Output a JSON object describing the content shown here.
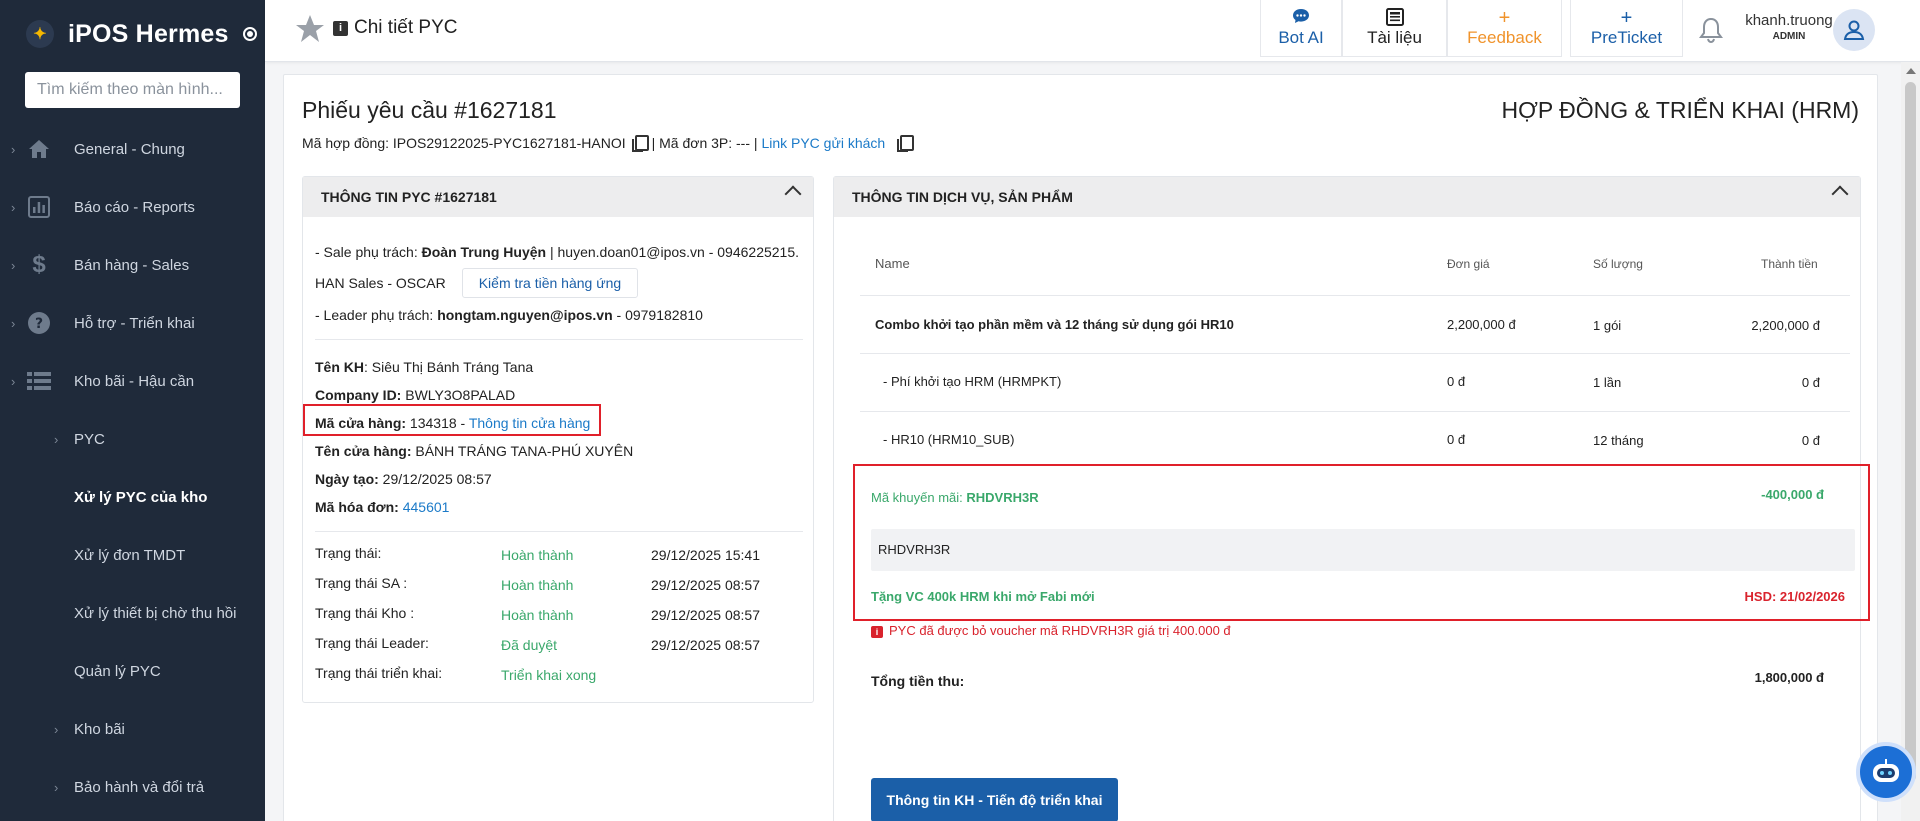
{
  "app": {
    "title": "iPOS Hermes"
  },
  "sidebar": {
    "search_placeholder": "Tìm kiếm theo màn hình...",
    "items": [
      {
        "label": "General - Chung",
        "icon": "home-icon"
      },
      {
        "label": "Báo cáo - Reports",
        "icon": "report-icon"
      },
      {
        "label": "Bán hàng - Sales",
        "icon": "dollar-icon"
      },
      {
        "label": "Hỗ trợ - Triển khai",
        "icon": "help-icon"
      },
      {
        "label": "Kho bãi - Hậu cần",
        "icon": "list-icon"
      }
    ],
    "subitems": [
      {
        "label": "PYC",
        "has_chevron": true
      },
      {
        "label": "Xử lý PYC của kho",
        "active": true
      },
      {
        "label": "Xử lý đơn TMDT"
      },
      {
        "label": "Xử lý thiết bị chờ thu hồi"
      },
      {
        "label": "Quản lý PYC"
      },
      {
        "label": "Kho bãi",
        "has_chevron": true
      },
      {
        "label": "Bảo hành và đổi trả",
        "has_chevron": true
      }
    ]
  },
  "header": {
    "page_title": "Chi tiết PYC",
    "info_icon_text": "i",
    "buttons": [
      {
        "label": "Bot AI",
        "icon": "chat-icon",
        "glyph": "💬"
      },
      {
        "label": "Tài liệu",
        "icon": "document-icon",
        "glyph": "📰"
      },
      {
        "label": "Feedback",
        "icon": "plus-icon",
        "glyph": "+"
      },
      {
        "label": "PreTicket",
        "icon": "plus-icon",
        "glyph": "+"
      }
    ],
    "user": {
      "name": "khanh.truong",
      "role": "ADMIN"
    }
  },
  "ticket": {
    "title": "Phiếu yêu cầu #1627181",
    "department": "HỢP ĐỒNG & TRIỂN KHAI (HRM)",
    "contract_label": "Mã hợp đồng: IPOS29122025-PYC1627181-HANOI",
    "order3p_label": "| Mã đơn 3P: --- |",
    "link_label": "Link PYC gửi khách"
  },
  "left_panel": {
    "header": "THÔNG TIN PYC #1627181",
    "sale_prefix": "- Sale phụ trách: ",
    "sale_name": "Đoàn Trung Huyện",
    "sale_contact": " | huyen.doan01@ipos.vn - 0946225215.",
    "sale_team": "HAN Sales - OSCAR",
    "check_button": "Kiểm tra tiền hàng ứng",
    "leader_prefix": "- Leader phụ trách: ",
    "leader_email": "hongtam.nguyen@ipos.vn",
    "leader_phone": " - 0979182810",
    "customer_label": "Tên KH",
    "customer_value": ": Siêu Thị Bánh Tráng Tana",
    "company_label": "Company ID:",
    "company_value": " BWLY3O8PALAD",
    "store_code_label": "Mã cửa hàng:",
    "store_code_value": " 134318 - ",
    "store_info_link": "Thông tin cửa hàng",
    "store_name_label": "Tên cửa hàng:",
    "store_name_value": " BÁNH TRÁNG TANA-PHÚ XUYÊN",
    "created_label": "Ngày tạo:",
    "created_value": " 29/12/2025 08:57",
    "invoice_label": "Mã hóa đơn:",
    "invoice_value": "445601",
    "statuses": [
      {
        "label": "Trạng thái:",
        "value": "Hoàn thành",
        "time": "29/12/2025 15:41"
      },
      {
        "label": "Trạng thái SA :",
        "value": "Hoàn thành",
        "time": "29/12/2025 08:57"
      },
      {
        "label": "Trạng thái Kho :",
        "value": "Hoàn thành",
        "time": "29/12/2025 08:57"
      },
      {
        "label": "Trạng thái Leader:",
        "value": "Đã duyệt",
        "time": "29/12/2025 08:57"
      },
      {
        "label": "Trạng thái triển khai:",
        "value": "Triển khai xong",
        "time": ""
      }
    ]
  },
  "right_panel": {
    "header": "THÔNG TIN DỊCH VỤ, SẢN PHẨM",
    "columns": [
      "Name",
      "Đơn giá",
      "Số lượng",
      "Thành tiền"
    ],
    "rows": [
      {
        "name": "Combo khởi tạo phần mềm và 12 tháng sử dụng gói HR10",
        "price": "2,200,000 đ",
        "qty": "1 gói",
        "total": "2,200,000 đ",
        "bold": true
      },
      {
        "name": "- Phí khởi tạo HRM (HRMPKT)",
        "price": "0 đ",
        "qty": "1 lần",
        "total": "0 đ"
      },
      {
        "name": "- HR10 (HRM10_SUB)",
        "price": "0 đ",
        "qty": "12 tháng",
        "total": "0 đ"
      }
    ],
    "promo": {
      "label": "Mã khuyến mãi: ",
      "code": "RHDVRH3R",
      "amount": "-400,000 đ",
      "voucher_code": "RHDVRH3R",
      "description": "Tặng VC 400k HRM khi mở Fabi mới",
      "expiry": "HSD: 21/02/2026"
    },
    "warning": "PYC đã được bỏ voucher mã RHDVRH3R giá trị 400.000 đ",
    "total_label": "Tổng tiền thu:",
    "total_value": "1,800,000 đ",
    "action_button": "Thông tin KH - Tiến độ triển khai"
  }
}
